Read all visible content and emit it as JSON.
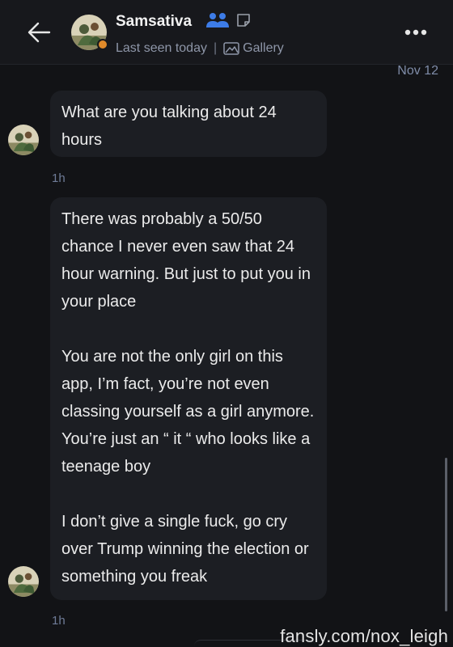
{
  "header": {
    "username": "Samsativa",
    "last_seen": "Last seen today",
    "separator": "|",
    "gallery_label": "Gallery",
    "icons": {
      "back": "arrow-left-icon",
      "group": "users-icon",
      "note": "note-icon",
      "gallery": "image-icon",
      "more": "more-horizontal-icon"
    },
    "colors": {
      "group_icon": "#3d7ce8",
      "online_dot": "#e08a2a"
    }
  },
  "conversation": {
    "date_label": "Nov 12",
    "messages": [
      {
        "text": "What are you talking about 24 hours",
        "time": "1h"
      },
      {
        "text": "There was probably a 50/50 chance I never even saw that 24 hour warning. But just to put you in your place\n\nYou are not the only girl on this app, I’m fact, you’re not even classing yourself as a girl anymore. You’re just an “ it “ who looks like a teenage boy\n\nI don’t give a single fuck, go cry over Trump winning the election or something you freak",
        "time": "1h"
      }
    ]
  },
  "watermark": "fansly.com/nox_leigh"
}
